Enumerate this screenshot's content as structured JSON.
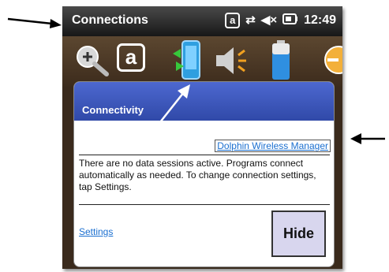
{
  "window": {
    "title": "Connections",
    "clock": "12:49",
    "status_icons": [
      "a-input-icon",
      "sync-arrows-icon",
      "speaker-mute-icon",
      "battery-charging-icon"
    ],
    "status_a_glyph": "a"
  },
  "iconbar": {
    "icons": [
      "magnifier-icon",
      "a-input-icon",
      "connectivity-phone-icon",
      "volume-icon",
      "battery-icon",
      "partial-icon"
    ],
    "a_glyph": "a"
  },
  "popup": {
    "title": "Connectivity",
    "wireless_link": "Dolphin Wireless Manager",
    "message": "There are no data sessions active. Programs connect automatically as needed. To change connection settings, tap Settings.",
    "settings_link": "Settings",
    "hide_button": "Hide",
    "header_color": "#3a55b8"
  },
  "annotations": {
    "arrow_color": "#000000"
  }
}
